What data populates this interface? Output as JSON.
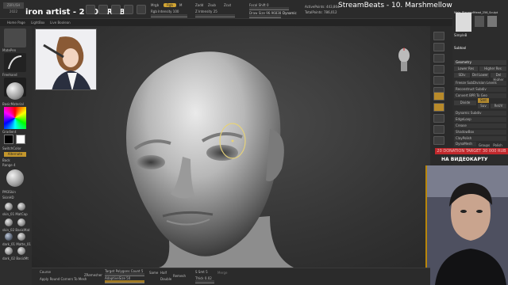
{
  "topbar": {
    "logo_label": "ZBRUSH 2022",
    "donation": "iron artist - 2 000 RUB",
    "stream_title": "StreamBeats - 10. Marshmellow Pie",
    "mrgb": "Mrgb",
    "rgb": "Rgb",
    "m": "M",
    "rgb_intensity": "Rgb Intensity 100",
    "zadd": "Zadd",
    "zsub": "Zsub",
    "zcut": "Zcut",
    "z_intensity": "Z Intensity 25",
    "focal_shift": "Focal Shift 0",
    "draw_size": "Draw Size 96.96838",
    "dynamic": "Dynamic",
    "active_points": "ActivePoints: 443,864",
    "total_points": "TotalPoints: 786,012"
  },
  "tabs": [
    "Home Page",
    "LightBox",
    "Live Boolean"
  ],
  "left_tray": {
    "brush1": "MatePen",
    "brush2": "Freehand",
    "brush3": "BasicMaterial",
    "gradient": "Gradient",
    "switch_color": "SwitchColor",
    "alternate": "Alternate",
    "back": "Back",
    "range": "Range 4",
    "material1": "PM3Skin",
    "material2": "SkinHD",
    "matcaps": [
      "skin_01 MatCap",
      "skin_02 BasicMat",
      "dark_01 Matte_01",
      "dark_02 BasicMt"
    ]
  },
  "right_icons": [
    "BPR",
    "SPix 3",
    "Scroll",
    "Zoom",
    "Actual",
    "AAHalf",
    "Persp",
    "Floor",
    "Local",
    "Frame",
    "Move",
    "Scale",
    "Rotate",
    "Transp"
  ],
  "right_panel": {
    "subtool_name": "Male_PlanesofHead_256_Sculpt",
    "icons": [
      "Cylinder",
      "Claymore"
    ],
    "simple": "SimpleB",
    "subtool": "Subtool",
    "geometry": "Geometry",
    "lower_res": "Lower Res",
    "higher_res": "Higher Res",
    "sdiv": "SDiv",
    "del_lower": "Del Lower",
    "del_higher": "Del Higher",
    "freeze_subdiv": "Freeze SubDivision Levels",
    "reconstruct": "Reconstruct Subdiv",
    "convert_bpr": "Convert BPR To Geo",
    "divide": "Divide",
    "smt": "Smt",
    "suv": "Suv",
    "reuv": "ReUV",
    "dynamic_subdiv": "Dynamic Subdiv",
    "edge_loop": "EdgeLoop",
    "crease": "Crease",
    "shadowbox": "ShadowBox",
    "clay_polish": "ClayPolish",
    "dynamesh": "DynaMesh",
    "groups": "Groups",
    "polish": "Polish",
    "alert": "20 DONATION TARGET 30 000 RUB",
    "alert_text": "НА ВИДЕОКАРТУ"
  },
  "bottombar": {
    "course": "Course",
    "apply_round": "Apply Round Corners To Mesh",
    "zremesher": "ZRemesher",
    "target_poly": "Target Polygons Count 5",
    "adaptive": "AdaptiveSize 50",
    "same": "Same",
    "half": "Half",
    "double": "Double",
    "remesh": "Remesh",
    "sdiv": "S Smt 5",
    "thick": "Thick 0.02",
    "merge": "Merge"
  },
  "colors": {
    "accent": "#d2a533",
    "alert": "#c0282c"
  }
}
